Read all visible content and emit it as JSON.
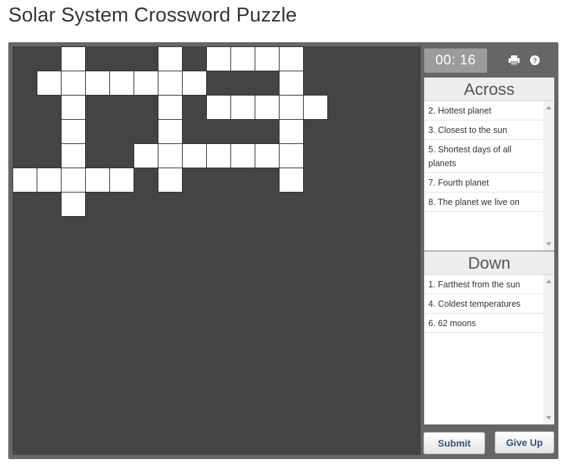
{
  "page": {
    "title": "Solar System Crossword Puzzle"
  },
  "timer": {
    "display": "00: 16"
  },
  "toolbar": {
    "print_icon": "printer-icon",
    "help_icon": "help-icon"
  },
  "across": {
    "heading": "Across",
    "clues": [
      "2. Hottest planet",
      "3. Closest to the sun",
      "5. Shortest days of all planets",
      "7. Fourth planet",
      "8. The planet we live on"
    ]
  },
  "down": {
    "heading": "Down",
    "clues": [
      "1. Farthest from the sun",
      "4. Coldest temperatures",
      "6. 62 moons"
    ]
  },
  "buttons": {
    "submit": "Submit",
    "give_up": "Give Up"
  },
  "colors": {
    "frame": "#666666",
    "board": "#444444",
    "cell": "#ffffff",
    "button_text": "#3a4f7a"
  }
}
